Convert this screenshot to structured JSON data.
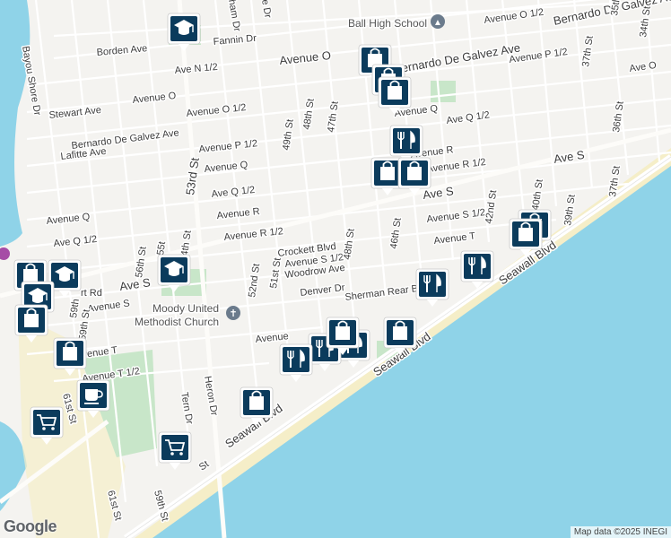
{
  "streets": {
    "avenue_o_half_top": "Avenue O 1/2",
    "bernardo_top": "Bernardo De Galvez Ave",
    "fannin": "Fannin Dr",
    "borden": "Borden Ave",
    "ave_n_half": "Ave N 1/2",
    "avenue_o": "Avenue O",
    "bernardo_mid": "Bernardo De Galvez Ave",
    "avenue_p_half_right": "Avenue P 1/2",
    "ave_o_right": "Ave O",
    "stewart": "Stewart Ave",
    "avenue_o_left": "Avenue O",
    "avenue_o_half_left": "Avenue O 1/2",
    "avenue_q_right": "Avenue Q",
    "ave_q_half_right": "Ave Q 1/2",
    "lafitte": "Lafitte Ave",
    "bernardo_left": "Bernardo De Galvez Ave",
    "avenue_p_half_left": "Avenue P 1/2",
    "avenue_r_mid": "Avenue R",
    "ave_s_right": "Ave S",
    "avenue_r_half_mid": "Avenue R 1/2",
    "avenue_q_mid": "Avenue Q",
    "ave_q_half_mid": "Ave Q 1/2",
    "ave_s_mid": "Ave S",
    "avenue_r_left": "Avenue R",
    "avenue_r_half_left": "Avenue R 1/2",
    "avenue_s_half_right": "Avenue S 1/2",
    "avenue_q_far_left": "Avenue Q",
    "ave_q_half_far_left": "Ave Q 1/2",
    "crockett": "Crockett Blvd",
    "avenue_s_half_mid": "Avenue S 1/2",
    "avenue_t_right": "Avenue T",
    "woodrow": "Woodrow Ave",
    "ave_s_left": "Ave S",
    "denver": "Denver Dr",
    "sherman": "Sherman Rear Bl",
    "avenue_s_far_left": "Avenue S",
    "avenue_left_bottom": "Avenue",
    "ave_t_left": "Avenue T",
    "ave_t_half": "Avenue T 1/2",
    "seawall_right": "Seawall Blvd",
    "seawall_mid": "Seawall Blvd",
    "seawall_left": "Seawall Blvd",
    "bayou_shore": "Bayou Shore Dr",
    "st_35": "35th St",
    "st_34": "34th St",
    "st_37_top": "37th St",
    "st_36": "36th St",
    "st_37_bottom": "37th St",
    "st_40": "40th St",
    "st_39": "39th St",
    "st_42": "42nd St",
    "st_46": "46th St",
    "st_47": "47th St",
    "st_48_top": "48th St",
    "st_49": "49th St",
    "st_48_bottom": "48th St",
    "st_51": "51st St",
    "st_52": "52nd St",
    "st_53": "53rd St",
    "st_54": "54th St",
    "st_55": "55t",
    "st_56": "56th St",
    "st_59": "59th St",
    "st_61_a": "61st St",
    "st_61_b": "61st St",
    "heron": "Heron Dr",
    "tern": "Tern Dr",
    "ham_dr": "ham Dr",
    "de_dr": "e Dr",
    "st_59_left": "59th",
    "t_rd": "rt Rd",
    "st_fragment": "St",
    "st_51_small": "St"
  },
  "pois": {
    "ball_high": "Ball High School",
    "moody_line1": "Moody United",
    "moody_line2": "Methodist Church"
  },
  "markers": [
    {
      "type": "school",
      "icon": "school-icon"
    },
    {
      "type": "shopping",
      "icon": "shopping-bag-icon"
    },
    {
      "type": "shopping",
      "icon": "shopping-bag-icon"
    },
    {
      "type": "shopping",
      "icon": "shopping-bag-icon"
    },
    {
      "type": "restaurant",
      "icon": "restaurant-icon"
    },
    {
      "type": "shopping",
      "icon": "shopping-bag-icon"
    },
    {
      "type": "shopping",
      "icon": "shopping-bag-icon"
    },
    {
      "type": "shopping",
      "icon": "shopping-bag-icon"
    },
    {
      "type": "shopping",
      "icon": "shopping-bag-icon"
    },
    {
      "type": "restaurant",
      "icon": "restaurant-icon"
    },
    {
      "type": "restaurant",
      "icon": "restaurant-icon"
    },
    {
      "type": "school",
      "icon": "school-icon"
    },
    {
      "type": "shopping",
      "icon": "shopping-bag-icon"
    },
    {
      "type": "school",
      "icon": "school-icon"
    },
    {
      "type": "school",
      "icon": "school-icon"
    },
    {
      "type": "shopping",
      "icon": "shopping-bag-icon"
    },
    {
      "type": "shopping",
      "icon": "shopping-bag-icon"
    },
    {
      "type": "restaurant",
      "icon": "restaurant-icon"
    },
    {
      "type": "restaurant",
      "icon": "restaurant-icon"
    },
    {
      "type": "restaurant",
      "icon": "restaurant-icon"
    },
    {
      "type": "shopping",
      "icon": "shopping-bag-icon"
    },
    {
      "type": "shopping",
      "icon": "shopping-bag-icon"
    },
    {
      "type": "shopping",
      "icon": "shopping-bag-icon"
    },
    {
      "type": "cafe",
      "icon": "coffee-cup-icon"
    },
    {
      "type": "grocery",
      "icon": "shopping-cart-icon"
    },
    {
      "type": "grocery",
      "icon": "shopping-cart-icon"
    }
  ],
  "colors": {
    "land": "#f4f3f0",
    "water": "#8fd3e8",
    "park": "#c8e6c9",
    "beach": "#f5eec8",
    "road": "#ffffff",
    "major_road": "#fdfcf9",
    "marker": "#0b3b5c"
  },
  "attribution": "Map data ©2025 INEGI",
  "logo": "Google"
}
